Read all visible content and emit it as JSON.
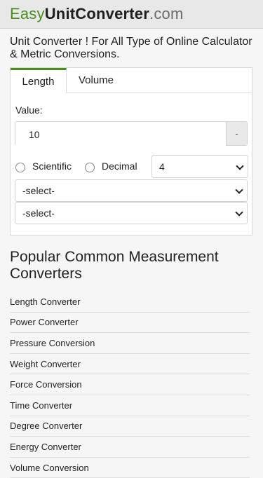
{
  "header": {
    "logo_part1": "Easy",
    "logo_part2": "UnitConverter",
    "logo_part3": ".com"
  },
  "tagline": "Unit Converter ! For All Type of Online Calculator & Metric Conversions.",
  "converter": {
    "tabs": [
      {
        "label": "Length",
        "active": true
      },
      {
        "label": "Volume",
        "active": false
      }
    ],
    "value_label": "Value:",
    "value": "10",
    "value_suffix": "-",
    "format_options": [
      {
        "label": "Scientific",
        "checked": false
      },
      {
        "label": "Decimal",
        "checked": false
      }
    ],
    "precision": "4",
    "from_unit": "-select-",
    "to_unit": "-select-"
  },
  "popular": {
    "heading": "Popular Common Measurement Converters",
    "items": [
      "Length Converter",
      "Power Converter",
      "Pressure Conversion",
      "Weight Converter",
      "Force Conversion",
      "Time Converter",
      "Degree Converter",
      "Energy Converter",
      "Volume Conversion"
    ]
  },
  "colors": {
    "brand_green": "#4a8f1c",
    "header_bg": "#e8e8e8",
    "page_bg": "#f6f6f6"
  }
}
